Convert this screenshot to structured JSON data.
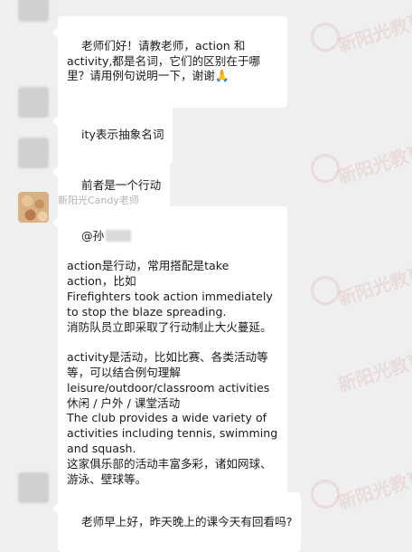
{
  "messages": [
    {
      "name": "",
      "text": "老师们好！请教老师，action 和activity,都是名词，它们的区别在于哪里？请用例句说明一下，谢谢",
      "emoji": "🙏"
    },
    {
      "name": "",
      "text": "ity表示抽象名词"
    },
    {
      "name": "",
      "text": "前者是一个行动"
    },
    {
      "name": "新阳光Candy老师",
      "mention": "@孙",
      "text": "action是行动，常用搭配是take action，比如\nFirefighters took action immediately to stop the blaze spreading.\n消防队员立即采取了行动制止大火蔓延。\n\nactivity是活动，比如比赛、各类活动等等，可以结合例句理解\nleisure/outdoor/classroom activities\n休闲 / 户外 / 课堂活动\nThe club provides a wide variety of activities including tennis, swimming and squash.\n这家俱乐部的活动丰富多彩，诸如网球、游泳、壁球等。"
    },
    {
      "name": "",
      "text": "老师早上好，昨天晚上的课今天有回看吗?"
    }
  ],
  "watermark": "新阳光教育"
}
